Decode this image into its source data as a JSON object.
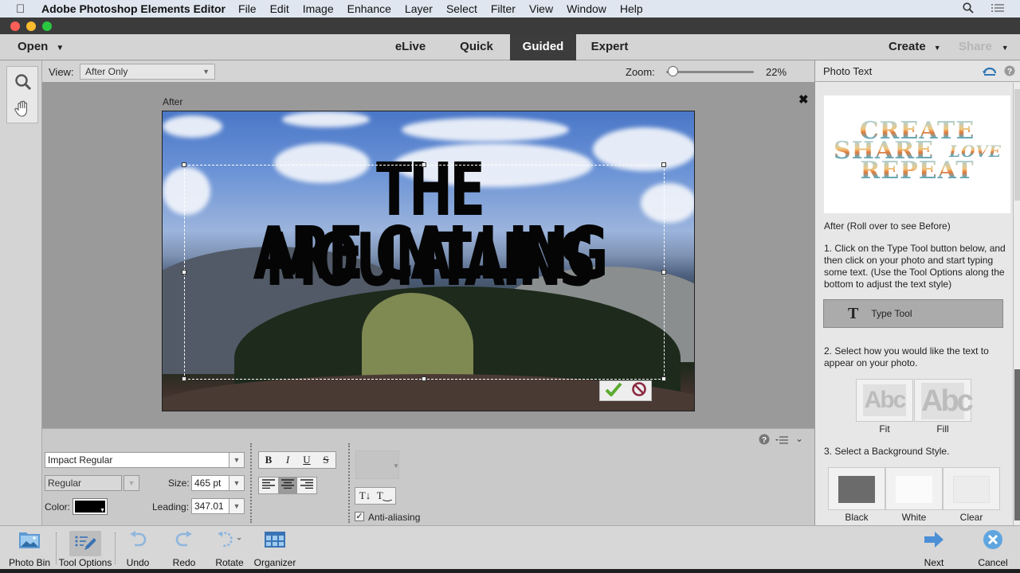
{
  "menubar": {
    "app_name": "Adobe Photoshop Elements Editor",
    "items": [
      "File",
      "Edit",
      "Image",
      "Enhance",
      "Layer",
      "Select",
      "Filter",
      "View",
      "Window",
      "Help"
    ]
  },
  "modebar": {
    "open_label": "Open",
    "modes": [
      {
        "label": "eLive",
        "active": false
      },
      {
        "label": "Quick",
        "active": false
      },
      {
        "label": "Guided",
        "active": true
      },
      {
        "label": "Expert",
        "active": false
      }
    ],
    "create_label": "Create",
    "share_label": "Share"
  },
  "viewbar": {
    "view_label": "View:",
    "view_value": "After Only",
    "zoom_label": "Zoom:",
    "zoom_value": "22%",
    "zoom_fraction": 0.05
  },
  "canvas": {
    "after_label": "After",
    "photo_text_line1": "THE MOUNTAINS",
    "photo_text_line2": "ARE CALLING"
  },
  "tool_options": {
    "font_family": "Impact Regular",
    "font_style": "Regular",
    "size_label": "Size:",
    "size_value": "465 pt",
    "color_label": "Color:",
    "color_value": "#000000",
    "leading_label": "Leading:",
    "leading_value": "347.01",
    "style_buttons": [
      "B",
      "I",
      "U",
      "S"
    ],
    "align_buttons": [
      "align-left",
      "align-center",
      "align-right"
    ],
    "align_selected": "align-center",
    "anti_aliasing_label": "Anti-aliasing",
    "anti_aliasing_checked": true
  },
  "panel": {
    "title": "Photo Text",
    "preview_lines": [
      "CREATE",
      "SHARE",
      "LOVE",
      "REPEAT"
    ],
    "preview_caption": "After (Roll over to see Before)",
    "step1": "1. Click on the Type Tool button below, and then click on your photo and start typing some text. (Use the Tool Options along the bottom to adjust the text style)",
    "type_tool_label": "Type Tool",
    "step2": "2. Select how you would like the text to appear on your photo.",
    "text_modes": [
      "Fit",
      "Fill"
    ],
    "step3": "3. Select a Background Style.",
    "bg_styles": [
      "Black",
      "White",
      "Clear"
    ]
  },
  "bottombar": {
    "items": [
      "Photo Bin",
      "Tool Options",
      "Undo",
      "Redo",
      "Rotate",
      "Organizer"
    ],
    "next_label": "Next",
    "cancel_label": "Cancel"
  }
}
